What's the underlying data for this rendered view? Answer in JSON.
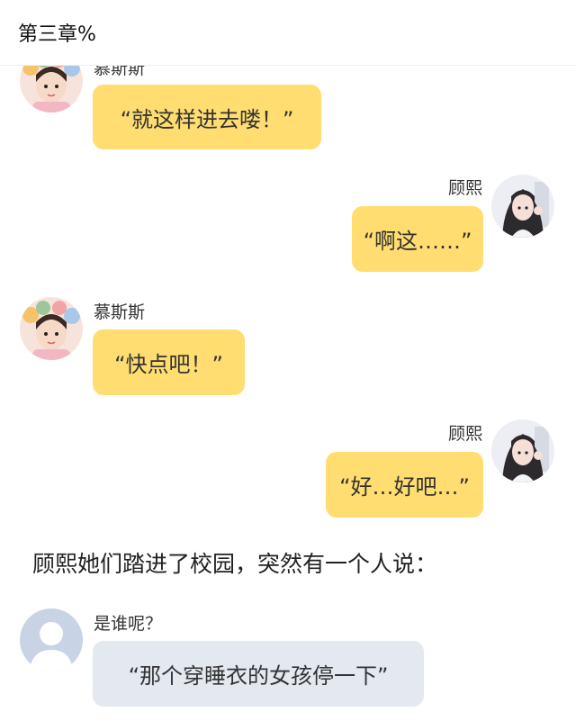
{
  "header": {
    "title": "第三章%"
  },
  "messages": [
    {
      "name": "慕斯斯",
      "text": "“就这样进去喽！”",
      "side": "left",
      "avatar": "girl-bow-avatar"
    },
    {
      "name": "顾熙",
      "text": "“啊这……”",
      "side": "right",
      "avatar": "girl-photo-avatar"
    },
    {
      "name": "慕斯斯",
      "text": "“快点吧！”",
      "side": "left",
      "avatar": "girl-bow-avatar"
    },
    {
      "name": "顾熙",
      "text": "“好…好吧…”",
      "side": "right",
      "avatar": "girl-photo-avatar"
    }
  ],
  "narration": "顾熙她们踏进了校园，突然有一个人说：",
  "unknown_message": {
    "name": "是谁呢？",
    "text": "“那个穿睡衣的女孩停一下”",
    "avatar": "default-user-avatar"
  },
  "colors": {
    "bubble_yellow": "#ffdd70",
    "bubble_grey": "#e4e8ef"
  }
}
